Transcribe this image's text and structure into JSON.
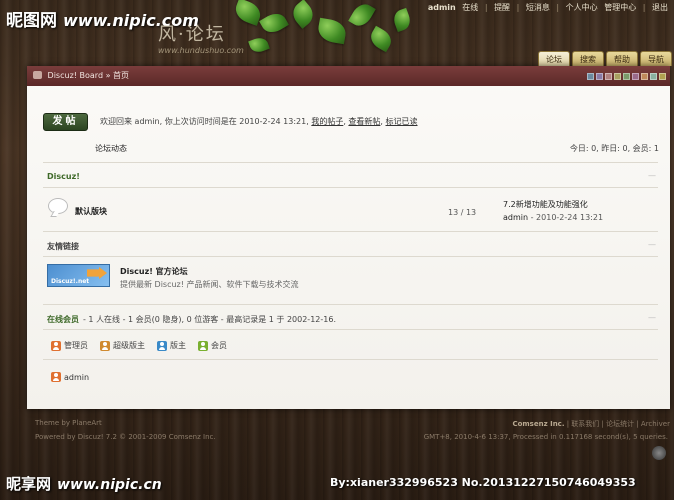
{
  "watermark": {
    "site_name": "昵图网",
    "url": "www.nipic.com",
    "bottom_site_name": "昵享网",
    "bottom_url": "www.nipic.cn",
    "id_text": "By:xianer332996523  No.20131227150746049353"
  },
  "logo": {
    "text": "风·论坛",
    "subtitle": "www.hundushuo.com"
  },
  "topnav": [
    "admin",
    "在线",
    "提醒",
    "短消息",
    "个人中心",
    "管理中心",
    "退出"
  ],
  "tabs": [
    {
      "label": "论坛",
      "active": true
    },
    {
      "label": "搜索",
      "active": false
    },
    {
      "label": "帮助",
      "active": false
    },
    {
      "label": "导航",
      "active": false
    }
  ],
  "breadcrumb": "Discuz! Board » 首页",
  "swatch_colors": [
    "#6c8aa0",
    "#8a7aa6",
    "#b08080",
    "#a8a060",
    "#7a9a6a",
    "#9a6a8a",
    "#c08a5a",
    "#8ab0a0",
    "#b0a050"
  ],
  "post_button": "发帖",
  "welcome": {
    "text": "欢迎回来 admin, 你上次访问时间是在 2010-2-24 13:21,",
    "link1": "我的帖子",
    "link2": "查看新帖",
    "link3": "标记已读"
  },
  "forum_news": "论坛动态",
  "stats": "今日: 0, 昨日: 0, 会员: 1",
  "category": "Discuz!",
  "forum": {
    "name": "默认版块",
    "count": "13 / 13",
    "last_title": "7.2新增功能及功能强化",
    "last_author": "admin",
    "last_time": "- 2010-2-24 13:21"
  },
  "links_title": "友情链接",
  "link": {
    "logo_text": "Discuz!.net",
    "name": "Discuz! 官方论坛",
    "desc": "提供最新 Discuz! 产品新闻、软件下载与技术交流"
  },
  "online": {
    "title": "在线会员",
    "summary": "- 1 人在线 - 1 会员(0 隐身), 0 位游客 - 最高记录是 1 于 2002-12-16.",
    "legend": [
      {
        "label": "管理员",
        "color": "#e07030"
      },
      {
        "label": "超级版主",
        "color": "#d08a30"
      },
      {
        "label": "版主",
        "color": "#3a8ac8"
      },
      {
        "label": "会员",
        "color": "#7ab030"
      }
    ],
    "user": "admin"
  },
  "footer": {
    "theme": "Theme by PlaneArt",
    "powered": "Powered by Discuz! 7.2 © 2001-2009 Comsenz Inc.",
    "company": "Comsenz Inc.",
    "links": "| 联系我们 | 论坛统计 | Archiver",
    "gmt": "GMT+8, 2010-4-6 13:37, Processed in 0.117168 second(s), 5 queries."
  },
  "colors": {
    "panel_header": "#6b3030",
    "accent_green": "#3f6a2a",
    "post_button": "#3c5530",
    "tab_gold": "#d8c682"
  }
}
